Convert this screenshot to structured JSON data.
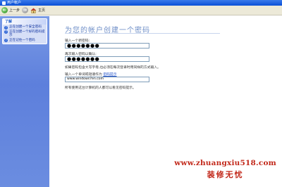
{
  "window": {
    "title": "用户帐户"
  },
  "toolbar": {
    "back_label": "上一步",
    "home_label": "主页"
  },
  "sidebar": {
    "panel_title": "了解",
    "items": [
      {
        "label": "正在创建一个安全密码"
      },
      {
        "label": "正在创建一个好的密码提示"
      },
      {
        "label": "正在记住一个密码"
      }
    ]
  },
  "main": {
    "heading": "为您的帐户创建一个密码",
    "new_password_label": "输入一个新密码:",
    "new_password_value": "●●●●●●●",
    "confirm_label": "再次输入密码以确认:",
    "confirm_value": "●●●●●●●",
    "case_note": "如果密码包含大写字母,也必须在每次登录时用同样的方式输入。",
    "hint_label_prefix": "输入一个单词或短语作为",
    "hint_label_link": "密码提示",
    "hint_value": "www.windows7en.com",
    "visibility_note": "所有使用这台计算机的人都可以看见密码提示。"
  },
  "watermark": {
    "url": "www.zhuangxiu518.com",
    "name": "装修无忧"
  }
}
